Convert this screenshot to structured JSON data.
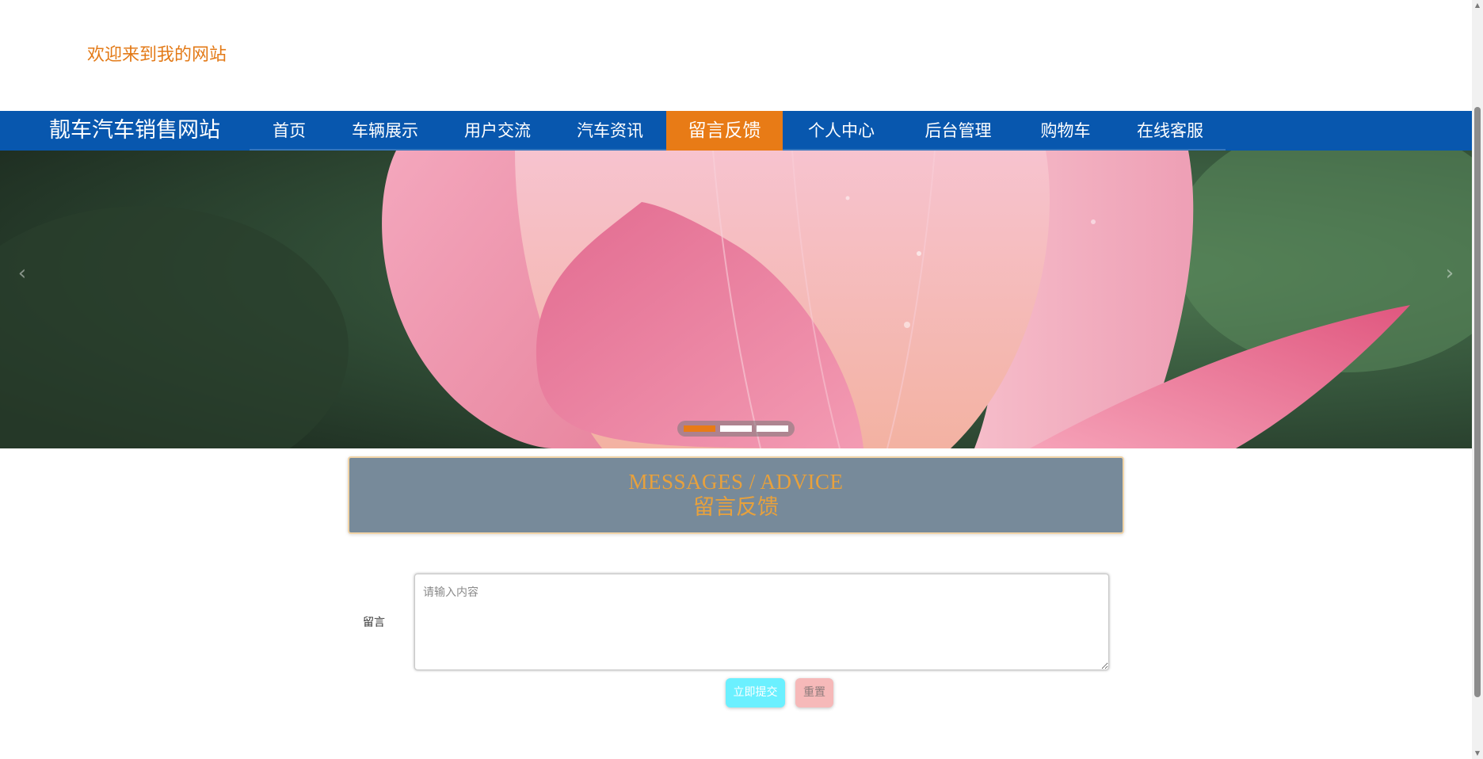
{
  "header": {
    "welcome_text": "欢迎来到我的网站"
  },
  "navbar": {
    "brand": "靓车汽车销售网站",
    "items": [
      {
        "label": "首页",
        "active": false
      },
      {
        "label": "车辆展示",
        "active": false
      },
      {
        "label": "用户交流",
        "active": false
      },
      {
        "label": "汽车资讯",
        "active": false
      },
      {
        "label": "留言反馈",
        "active": true
      },
      {
        "label": "个人中心",
        "active": false
      },
      {
        "label": "后台管理",
        "active": false
      },
      {
        "label": "购物车",
        "active": false
      },
      {
        "label": "在线客服",
        "active": false
      }
    ]
  },
  "carousel": {
    "prev_icon": "chevron-left-icon",
    "next_icon": "chevron-right-icon",
    "slide_count": 3,
    "active_index": 0
  },
  "section": {
    "title_en": "MESSAGES / ADVICE",
    "title_cn": "留言反馈"
  },
  "form": {
    "label": "留言",
    "textarea_placeholder": "请输入内容",
    "textarea_value": "",
    "submit_label": "立即提交",
    "reset_label": "重置"
  },
  "colors": {
    "nav_bg": "#0857ae",
    "accent": "#e87b16",
    "section_bg": "#778a9a",
    "section_text": "#e8a13c",
    "submit_bg": "#6bf0ff",
    "reset_bg": "#f6b9b9"
  }
}
